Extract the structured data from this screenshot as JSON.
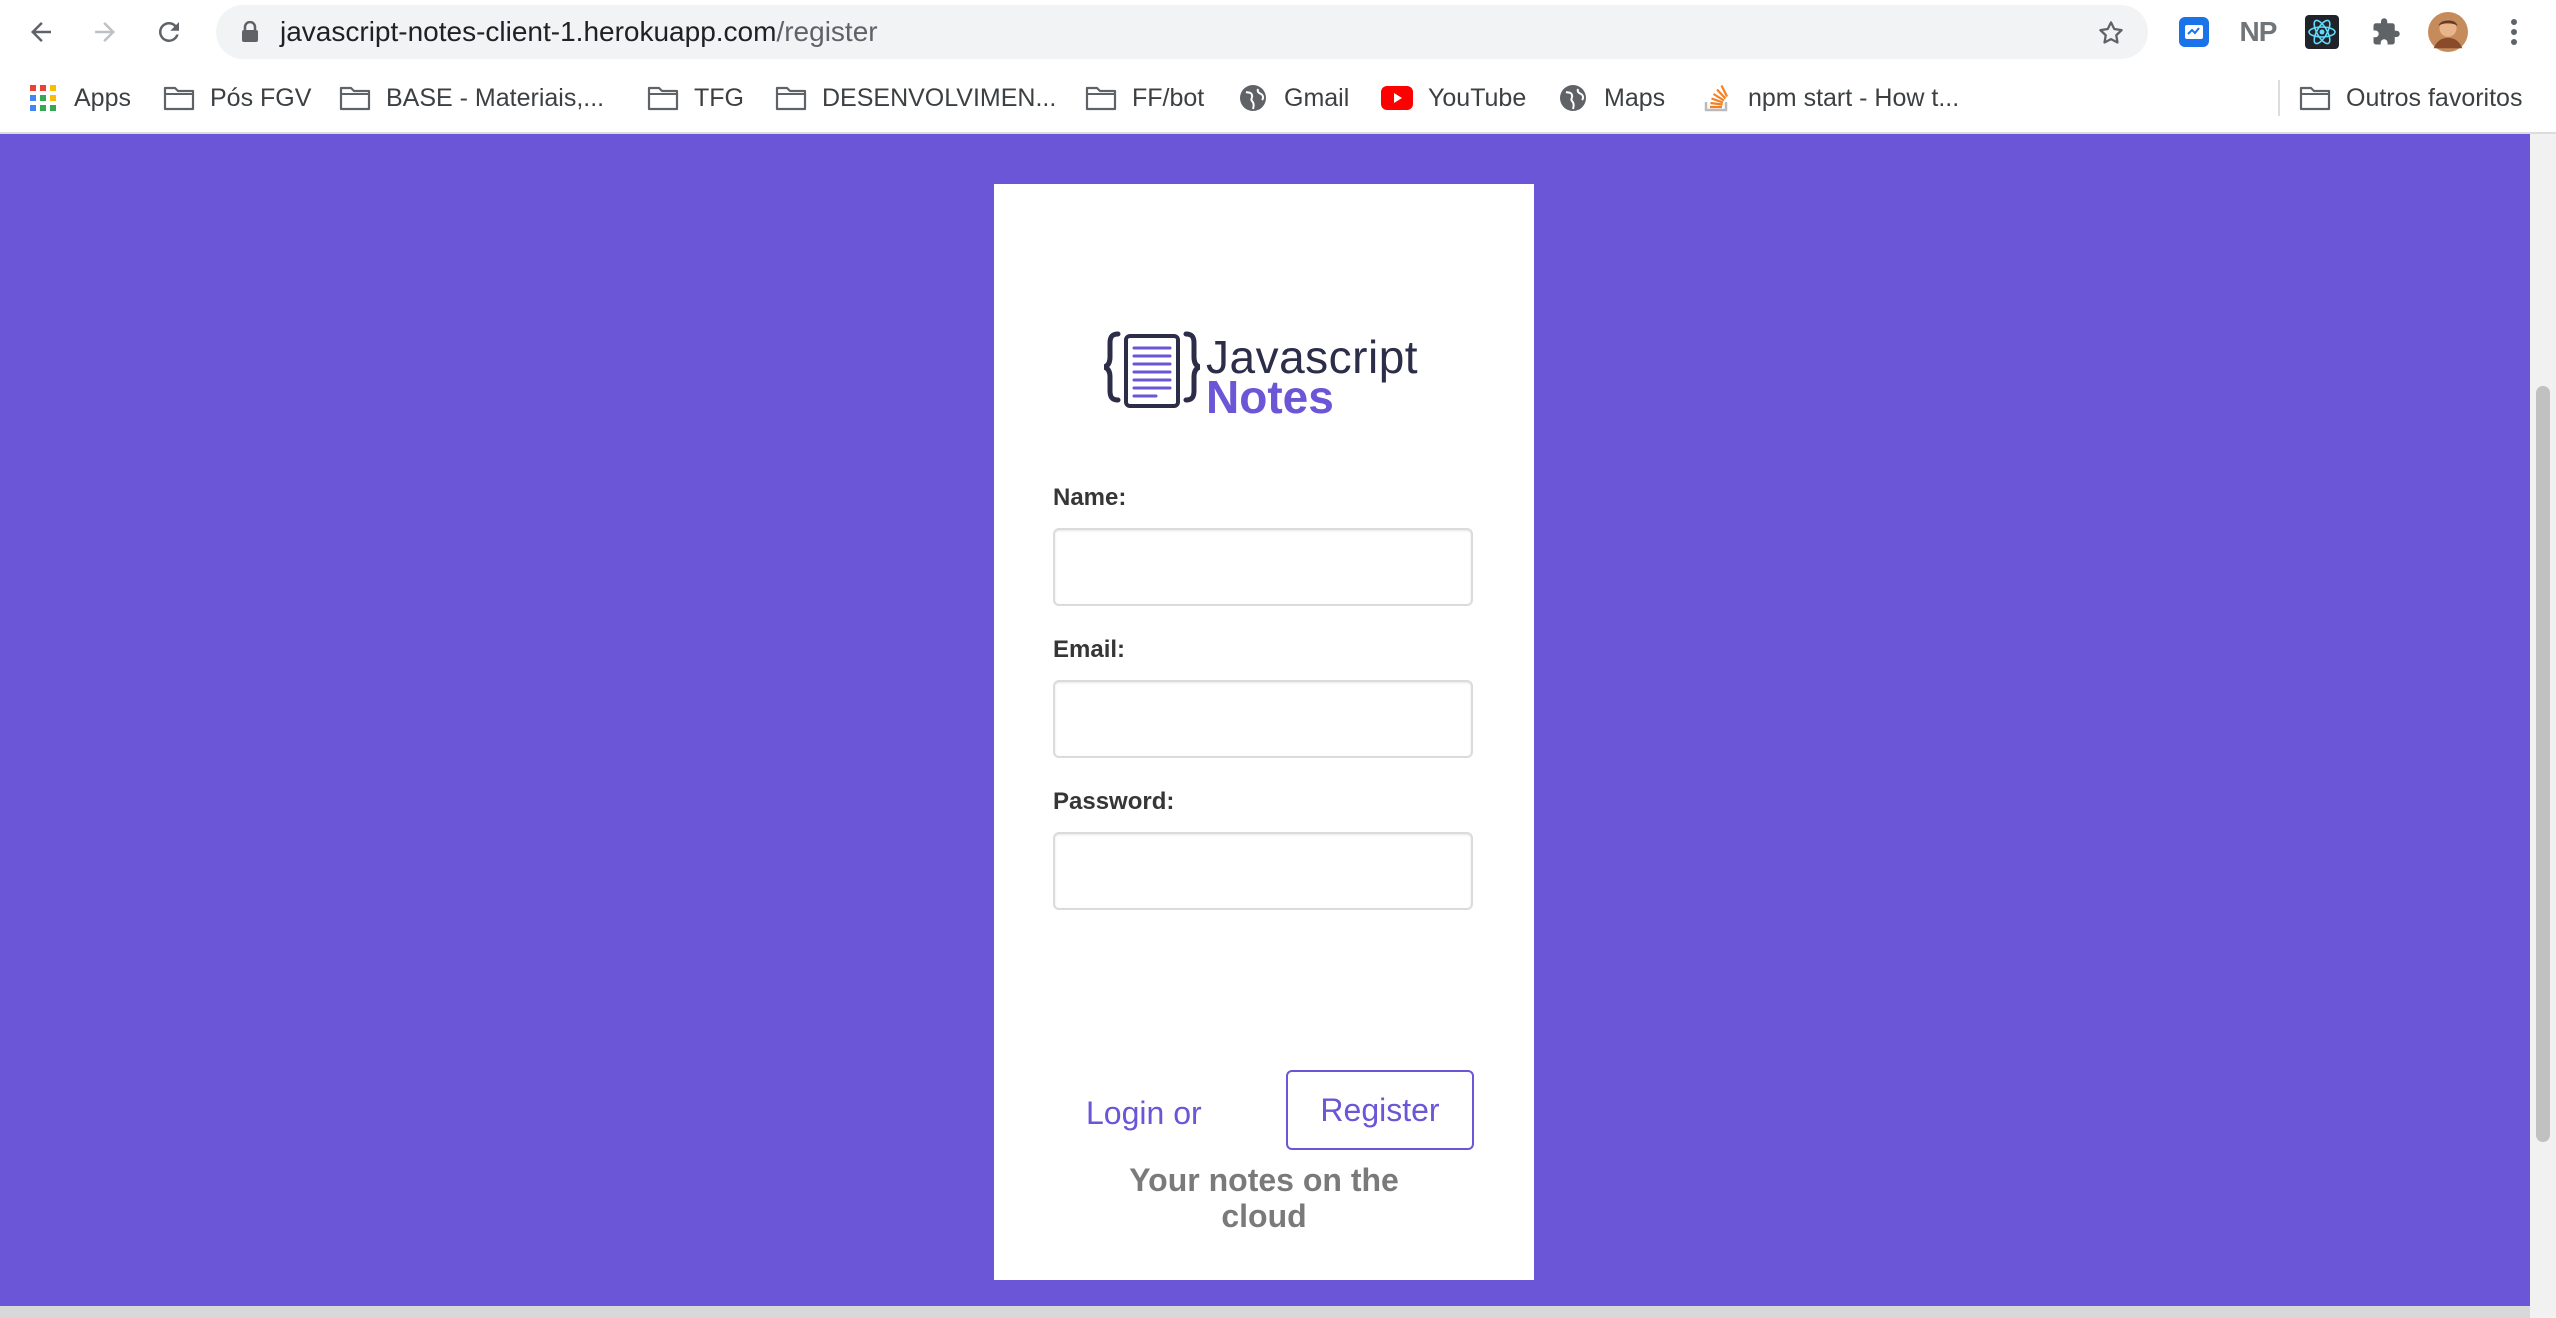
{
  "browser": {
    "url_host": "javascript-notes-client-1.herokuapp.com",
    "url_path": "/register",
    "extensions": [
      "extension-icon-1",
      "NP",
      "react-devtools-icon",
      "puzzle-icon"
    ]
  },
  "bookmarks": {
    "items": [
      {
        "label": "Apps",
        "icon": "apps-grid-icon"
      },
      {
        "label": "Pós FGV",
        "icon": "folder-icon"
      },
      {
        "label": "BASE - Materiais,...",
        "icon": "folder-icon"
      },
      {
        "label": "TFG",
        "icon": "folder-icon"
      },
      {
        "label": "DESENVOLVIMEN...",
        "icon": "folder-icon"
      },
      {
        "label": "FF/bot",
        "icon": "folder-icon"
      },
      {
        "label": "Gmail",
        "icon": "globe-icon"
      },
      {
        "label": "YouTube",
        "icon": "youtube-icon"
      },
      {
        "label": "Maps",
        "icon": "globe-icon"
      },
      {
        "label": "npm start - How t...",
        "icon": "stackoverflow-icon"
      }
    ],
    "other": "Outros favoritos"
  },
  "page": {
    "logo": {
      "word1": "Javascript",
      "word2": "Notes"
    },
    "form": {
      "name_label": "Name:",
      "email_label": "Email:",
      "password_label": "Password:",
      "name_value": "",
      "email_value": "",
      "password_value": ""
    },
    "login_link": "Login or",
    "register_button": "Register",
    "tagline": "Your notes on the cloud"
  },
  "colors": {
    "brand": "#6a56d6",
    "logo_dark": "#2c2d49"
  }
}
